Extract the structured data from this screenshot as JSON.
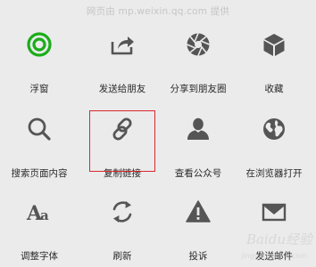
{
  "source_note": "网页由 mp.weixin.qq.com 提供",
  "accent_color": "#1aad19",
  "highlight_color": "#d8282c",
  "menu": {
    "row1": [
      {
        "label": "浮窗",
        "icon": "floating-window-icon"
      },
      {
        "label": "发送给朋友",
        "icon": "share-arrow-icon"
      },
      {
        "label": "分享到朋友圈",
        "icon": "moments-shutter-icon"
      },
      {
        "label": "收藏",
        "icon": "favorite-cube-icon"
      }
    ],
    "row2": [
      {
        "label": "搜索页面内容",
        "icon": "search-icon"
      },
      {
        "label": "复制链接",
        "icon": "link-icon"
      },
      {
        "label": "查看公众号",
        "icon": "person-icon"
      },
      {
        "label": "在浏览器打开",
        "icon": "globe-icon"
      }
    ],
    "row3": [
      {
        "label": "调整字体",
        "icon": "font-size-icon"
      },
      {
        "label": "刷新",
        "icon": "refresh-icon"
      },
      {
        "label": "投诉",
        "icon": "warning-icon"
      },
      {
        "label": "发送邮件",
        "icon": "mail-icon"
      }
    ]
  },
  "watermark": {
    "text": "Baidu经验",
    "sub": "jingyan.baidu.com"
  }
}
